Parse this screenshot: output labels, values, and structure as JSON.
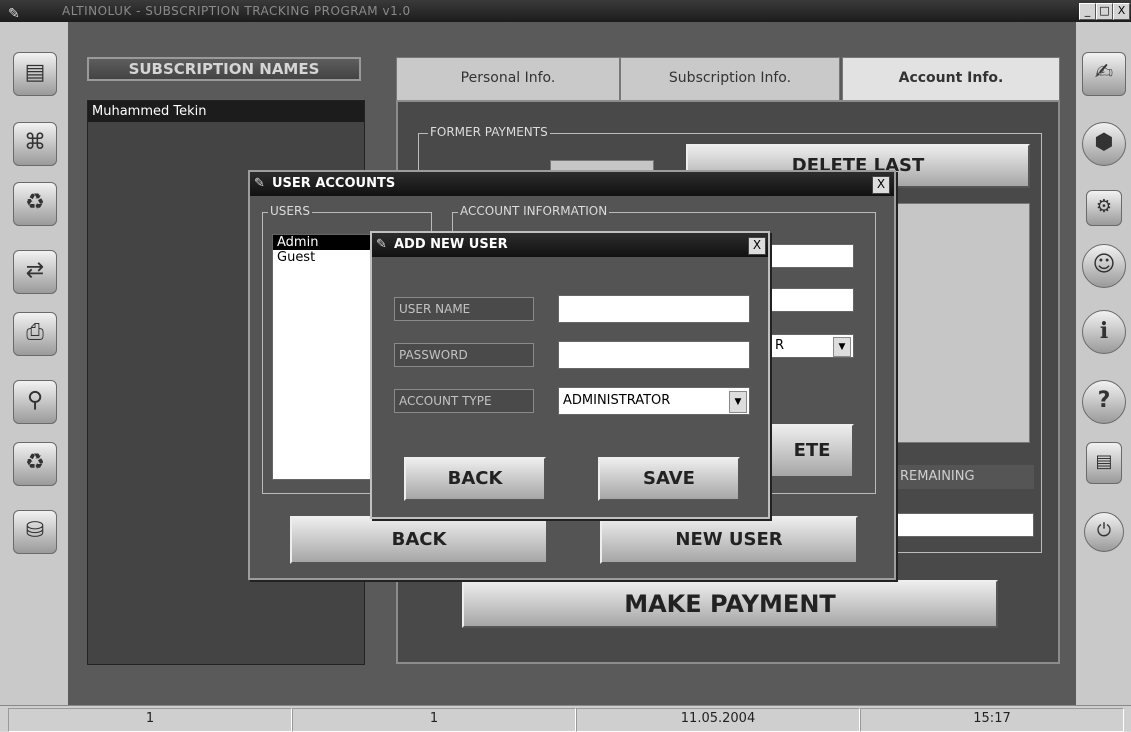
{
  "window": {
    "title": "ALTINOLUK - SUBSCRIPTION TRACKING PROGRAM v1.0",
    "min": "_",
    "max": "□",
    "close": "X"
  },
  "names_panel": {
    "header": "SUBSCRIPTION NAMES",
    "items": [
      "Muhammed Tekin"
    ]
  },
  "tabs": [
    {
      "label": "Personal Info."
    },
    {
      "label": "Subscription Info."
    },
    {
      "label": "Account Info."
    }
  ],
  "account_tab": {
    "former_payments_legend": "FORMER PAYMENTS",
    "delete_last_label": "DELETE LAST",
    "remaining_label": "REMAINING",
    "make_payment_label": "MAKE PAYMENT"
  },
  "user_accounts_dialog": {
    "title": "USER ACCOUNTS",
    "close": "X",
    "users_legend": "USERS",
    "users": [
      "Admin",
      "Guest"
    ],
    "account_info_legend": "ACCOUNT INFORMATION",
    "combo_value": "R",
    "delete_button": "ETE",
    "back_button": "BACK",
    "new_user_button": "NEW USER"
  },
  "add_user_dialog": {
    "title": "ADD NEW USER",
    "close": "X",
    "username_label": "USER NAME",
    "password_label": "PASSWORD",
    "account_type_label": "ACCOUNT TYPE",
    "username_value": "",
    "password_value": "",
    "account_type_value": "ADMINISTRATOR",
    "back_button": "BACK",
    "save_button": "SAVE"
  },
  "statusbar": {
    "cells": [
      "1",
      "1",
      "11.05.2004",
      "15:17"
    ]
  },
  "icons": {
    "left": [
      "document-icon",
      "network-icon",
      "recycle-icon",
      "transfer-icon",
      "stamp-icon",
      "search-icon",
      "recycle-icon",
      "coins-icon"
    ],
    "right": [
      "edit-icon",
      "box-icon",
      "settings-icon",
      "users-icon",
      "info-icon",
      "help-icon",
      "notes-icon",
      "power-icon"
    ]
  }
}
